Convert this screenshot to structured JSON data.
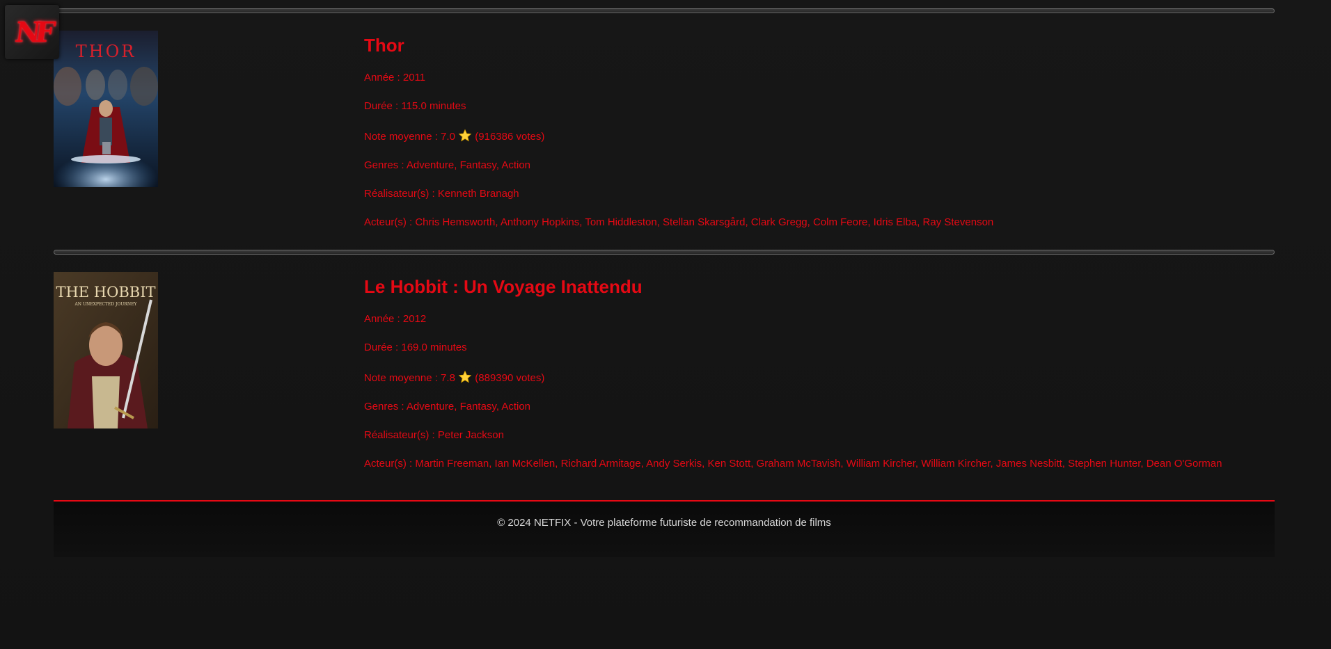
{
  "brand": {
    "logo_text": "NF",
    "accent": "#e50914"
  },
  "movies": [
    {
      "title": "Thor",
      "poster_text": "THOR",
      "year": "Année : 2011",
      "duration": "Durée : 115.0 minutes",
      "rating_prefix": "Note moyenne : 7.0",
      "rating_icon": "star-icon",
      "rating_votes": "(916386 votes)",
      "genres": "Genres : Adventure, Fantasy, Action",
      "directors": "Réalisateur(s) : Kenneth Branagh",
      "actors": "Acteur(s) : Chris Hemsworth, Anthony Hopkins, Tom Hiddleston, Stellan Skarsgård, Clark Gregg, Colm Feore, Idris Elba, Ray Stevenson"
    },
    {
      "title": "Le Hobbit : Un Voyage Inattendu",
      "poster_text": "THE HOBBIT",
      "poster_subtext": "AN UNEXPECTED JOURNEY",
      "year": "Année : 2012",
      "duration": "Durée : 169.0 minutes",
      "rating_prefix": "Note moyenne : 7.8",
      "rating_icon": "star-icon",
      "rating_votes": "(889390 votes)",
      "genres": "Genres : Adventure, Fantasy, Action",
      "directors": "Réalisateur(s) : Peter Jackson",
      "actors": "Acteur(s) : Martin Freeman, Ian McKellen, Richard Armitage, Andy Serkis, Ken Stott, Graham McTavish, William Kircher, William Kircher, James Nesbitt, Stephen Hunter, Dean O'Gorman"
    }
  ],
  "footer": {
    "text": "© 2024 NETFIX - Votre plateforme futuriste de recommandation de films"
  }
}
